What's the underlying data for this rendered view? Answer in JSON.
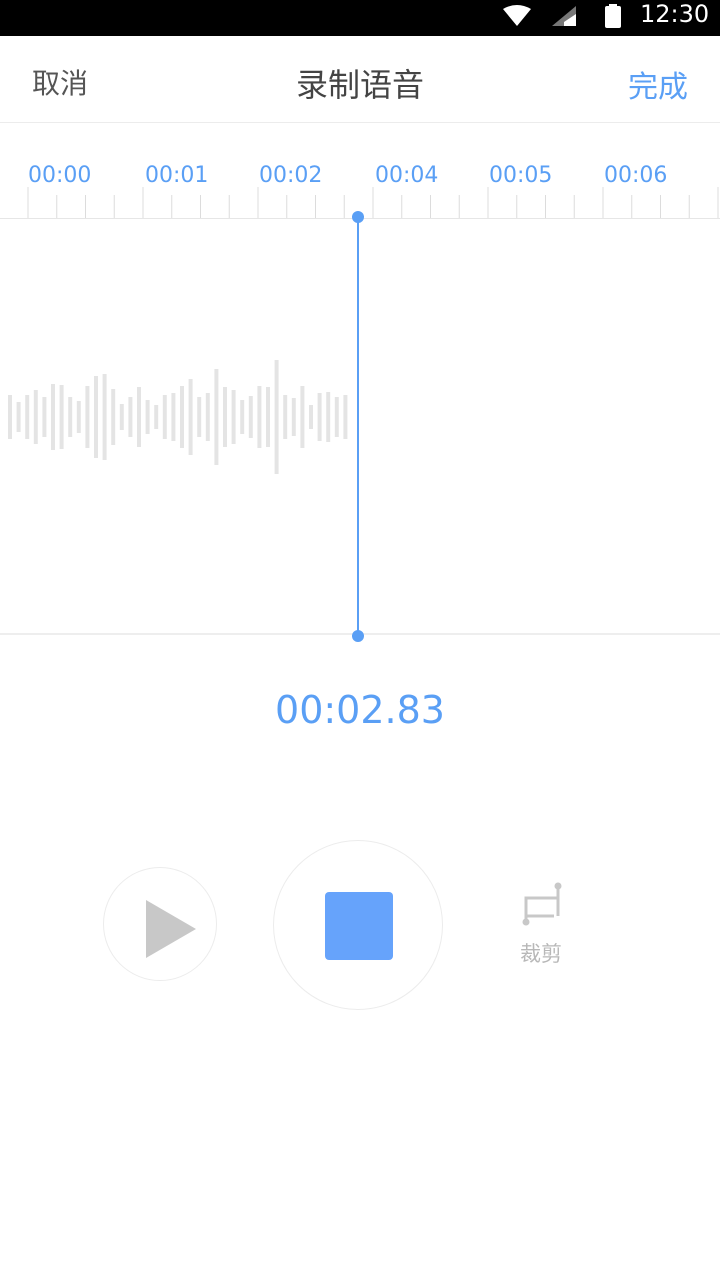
{
  "status_bar": {
    "time": "12:30",
    "icons": [
      "wifi-icon",
      "signal-icon",
      "battery-icon"
    ]
  },
  "header": {
    "cancel_label": "取消",
    "title": "录制语音",
    "done_label": "完成"
  },
  "ruler": {
    "labels": [
      "00:00",
      "00:01",
      "00:02",
      "00:04",
      "00:05",
      "00:06"
    ]
  },
  "recording": {
    "elapsed": "00:02.83"
  },
  "controls": {
    "play_icon": "play-icon",
    "stop_icon": "stop-icon",
    "trim_icon": "crop-icon",
    "trim_label": "裁剪"
  },
  "colors": {
    "accent": "#5a9ff5",
    "stop": "#66a3fb",
    "wave": "#e4e4e4",
    "disabled": "#c8c8c8"
  }
}
